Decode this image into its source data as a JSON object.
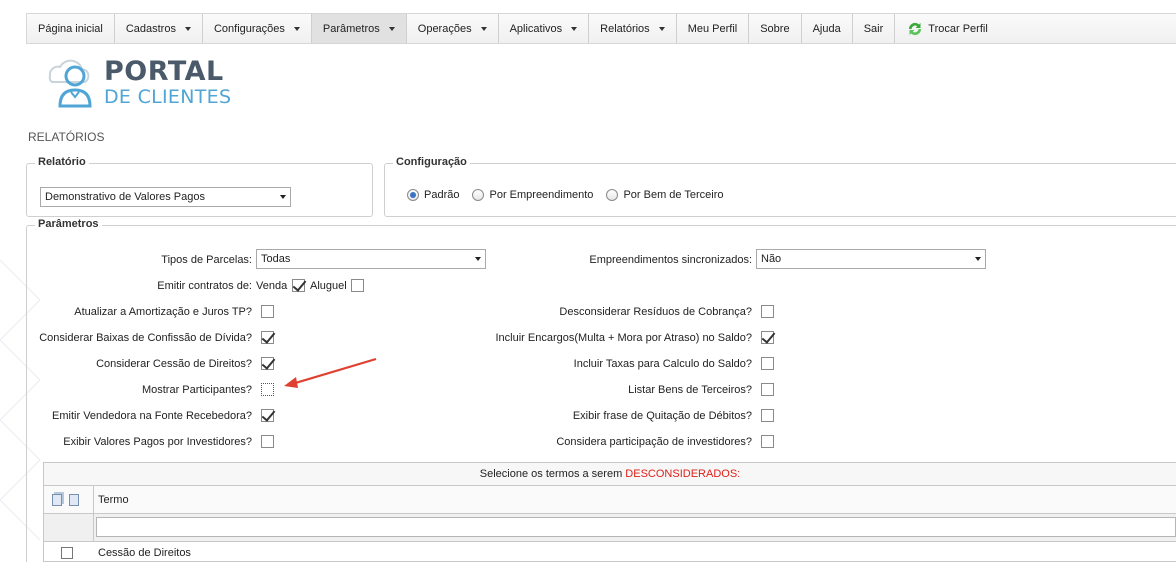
{
  "nav": {
    "items": [
      {
        "label": "Página inicial",
        "caret": false
      },
      {
        "label": "Cadastros",
        "caret": true
      },
      {
        "label": "Configurações",
        "caret": true
      },
      {
        "label": "Parâmetros",
        "caret": true
      },
      {
        "label": "Operações",
        "caret": true
      },
      {
        "label": "Aplicativos",
        "caret": true
      },
      {
        "label": "Relatórios",
        "caret": true
      },
      {
        "label": "Meu Perfil",
        "caret": false
      },
      {
        "label": "Sobre",
        "caret": false
      },
      {
        "label": "Ajuda",
        "caret": false
      },
      {
        "label": "Sair",
        "caret": false
      }
    ],
    "active_index": 3,
    "switch_profile": "Trocar Perfil"
  },
  "logo": {
    "word1": "PORTAL",
    "word2": "DE CLIENTES"
  },
  "section_title": "RELATÓRIOS",
  "relatorio": {
    "legend": "Relatório",
    "selected": "Demonstrativo de Valores Pagos"
  },
  "configuracao": {
    "legend": "Configuração",
    "options": [
      "Padrão",
      "Por Empreendimento",
      "Por Bem de Terceiro"
    ],
    "selected_index": 0
  },
  "parametros": {
    "legend": "Parâmetros",
    "tipos_parcelas_label": "Tipos de Parcelas:",
    "tipos_parcelas_value": "Todas",
    "emitir_contratos_label": "Emitir contratos de:",
    "venda_label": "Venda",
    "venda_checked": true,
    "aluguel_label": "Aluguel",
    "aluguel_checked": false,
    "left": [
      {
        "label": "Atualizar a Amortização e Juros TP?",
        "checked": false
      },
      {
        "label": "Considerar Baixas de Confissão de Dívida?",
        "checked": true
      },
      {
        "label": "Considerar Cessão de Direitos?",
        "checked": true
      },
      {
        "label": "Mostrar Participantes?",
        "checked": false
      },
      {
        "label": "Emitir Vendedora na Fonte Recebedora?",
        "checked": true
      },
      {
        "label": "Exibir Valores Pagos por Investidores?",
        "checked": false
      }
    ],
    "empreend_label": "Empreendimentos sincronizados:",
    "empreend_value": "Não",
    "right": [
      {
        "label": "Desconsiderar Resíduos de Cobrança?",
        "checked": false
      },
      {
        "label": "Incluir Encargos(Multa + Mora por Atraso) no Saldo?",
        "checked": true
      },
      {
        "label": "Incluir Taxas para Calculo do Saldo?",
        "checked": false
      },
      {
        "label": "Listar Bens de Terceiros?",
        "checked": false
      },
      {
        "label": "Exibir frase de Quitação de Débitos?",
        "checked": false
      },
      {
        "label": "Considera participação de investidores?",
        "checked": false
      }
    ]
  },
  "termos": {
    "header_prefix": "Selecione os termos a serem ",
    "header_highlight": "DESCONSIDERADOS:",
    "column": "Termo",
    "rows": [
      {
        "label": "Cessão de Direitos",
        "checked": false
      }
    ]
  },
  "colors": {
    "accent_red": "#e0201a",
    "radio_blue": "#3a74c4",
    "logo_dark": "#4a5a6a",
    "logo_light": "#4fa5d6"
  }
}
